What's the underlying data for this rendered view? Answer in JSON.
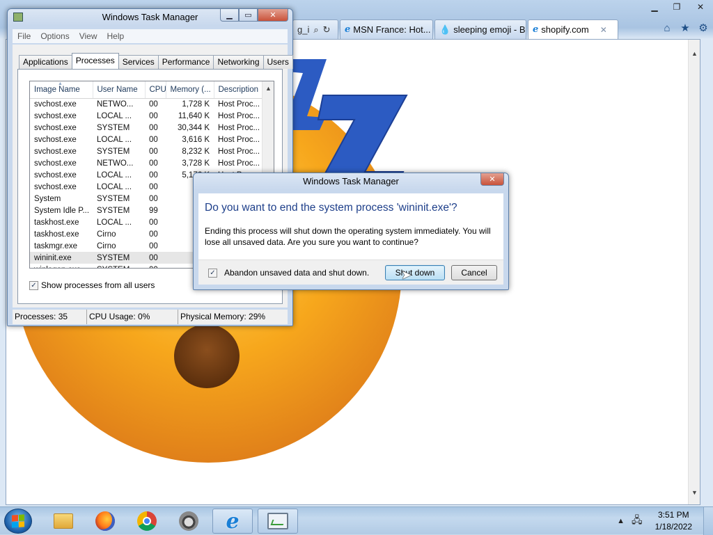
{
  "browser": {
    "tabs": [
      {
        "label": "MSN France: Hot...",
        "icon": "ie-page-icon"
      },
      {
        "label": "sleeping emoji - B...",
        "icon": "drop-icon"
      },
      {
        "label": "shopify.com",
        "icon": "ie-page-icon",
        "active": true
      }
    ],
    "address_fragment": "g_i",
    "close_tab_glyph": "✕"
  },
  "task_manager": {
    "title": "Windows Task Manager",
    "menu": [
      "File",
      "Options",
      "View",
      "Help"
    ],
    "tabs": [
      "Applications",
      "Processes",
      "Services",
      "Performance",
      "Networking",
      "Users"
    ],
    "active_tab": "Processes",
    "columns": [
      "Image Name",
      "User Name",
      "CPU",
      "Memory (...",
      "Description"
    ],
    "processes": [
      [
        "svchost.exe",
        "NETWO...",
        "00",
        "1,728 K",
        "Host Proc..."
      ],
      [
        "svchost.exe",
        "LOCAL ...",
        "00",
        "11,640 K",
        "Host Proc..."
      ],
      [
        "svchost.exe",
        "SYSTEM",
        "00",
        "30,344 K",
        "Host Proc..."
      ],
      [
        "svchost.exe",
        "LOCAL ...",
        "00",
        "3,616 K",
        "Host Proc..."
      ],
      [
        "svchost.exe",
        "SYSTEM",
        "00",
        "8,232 K",
        "Host Proc..."
      ],
      [
        "svchost.exe",
        "NETWO...",
        "00",
        "3,728 K",
        "Host Proc..."
      ],
      [
        "svchost.exe",
        "LOCAL ...",
        "00",
        "5,176 K",
        "Host Proc..."
      ],
      [
        "svchost.exe",
        "LOCAL ...",
        "00",
        "1,37",
        ""
      ],
      [
        "System",
        "SYSTEM",
        "00",
        "3",
        ""
      ],
      [
        "System Idle P...",
        "SYSTEM",
        "99",
        "2",
        ""
      ],
      [
        "taskhost.exe",
        "LOCAL ...",
        "00",
        "3,08",
        ""
      ],
      [
        "taskhost.exe",
        "Cirno",
        "00",
        "3,34",
        ""
      ],
      [
        "taskmgr.exe",
        "Cirno",
        "00",
        "1,98",
        ""
      ],
      [
        "wininit.exe",
        "SYSTEM",
        "00",
        "35",
        ""
      ],
      [
        "winlogon.exe",
        "SYSTEM",
        "00",
        "1,17",
        ""
      ]
    ],
    "selected_index": 13,
    "show_all_label": "Show processes from all users",
    "show_all_checked": true,
    "status": {
      "processes": "Processes: 35",
      "cpu": "CPU Usage: 0%",
      "memory": "Physical Memory: 29%"
    }
  },
  "dialog": {
    "title": "Windows Task Manager",
    "heading": "Do you want to end the system process 'wininit.exe'?",
    "body": "Ending this process will shut down the operating system immediately.  You will lose all unsaved data.  Are you sure you want to continue?",
    "checkbox_label": "Abandon unsaved data and shut down.",
    "checkbox_checked": true,
    "confirm_button": "Shut down",
    "cancel_button": "Cancel"
  },
  "taskbar": {
    "pinned": [
      "folder-icon",
      "firefox-icon",
      "chrome-icon",
      "raccoon-icon",
      "internet-explorer-icon",
      "task-manager-icon"
    ],
    "clock_time": "3:51 PM",
    "clock_date": "1/18/2022"
  },
  "colors": {
    "dialog_heading": "#1e3f8a",
    "emoji_face": "#f7a71c",
    "zzz": "#2c5bc2"
  }
}
